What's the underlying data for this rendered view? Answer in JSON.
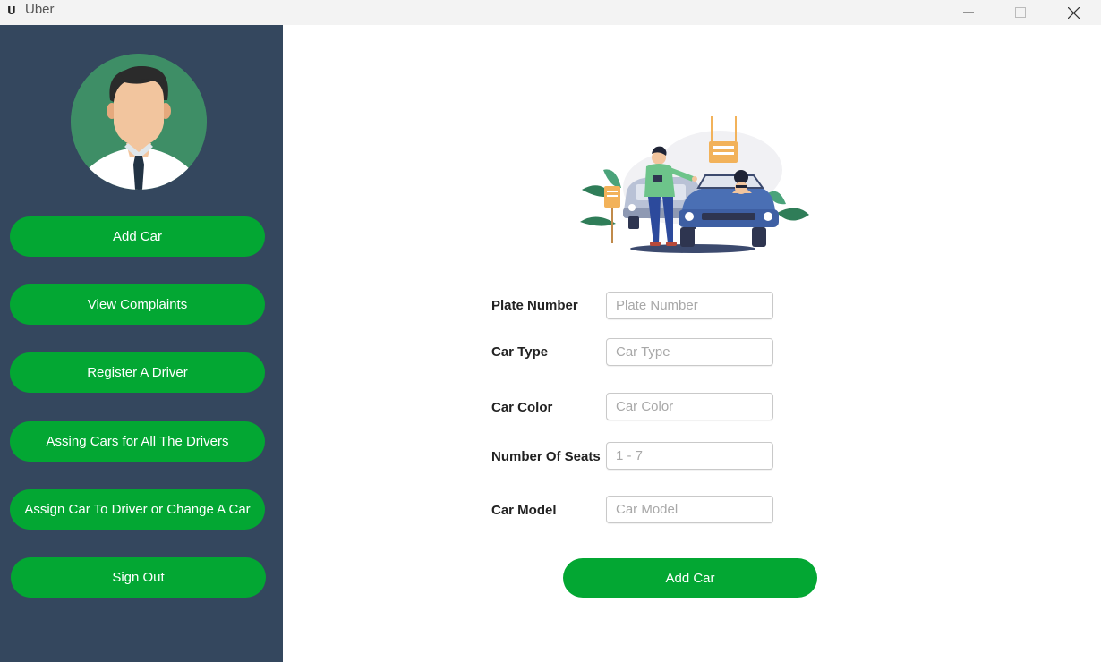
{
  "window": {
    "title": "Uber",
    "icon": "U"
  },
  "sidebar": {
    "items": [
      {
        "label": "Add Car"
      },
      {
        "label": "View Complaints"
      },
      {
        "label": "Register A Driver"
      },
      {
        "label": "Assing Cars for All The Drivers"
      },
      {
        "label": "Assign Car To Driver or Change A Car"
      },
      {
        "label": "Sign Out"
      }
    ]
  },
  "form": {
    "fields": [
      {
        "label": "Plate Number",
        "placeholder": "Plate Number",
        "value": ""
      },
      {
        "label": "Car Type",
        "placeholder": "Car Type",
        "value": ""
      },
      {
        "label": "Car Color",
        "placeholder": "Car Color",
        "value": ""
      },
      {
        "label": "Number Of Seats",
        "placeholder": "1 - 7",
        "value": ""
      },
      {
        "label": "Car Model",
        "placeholder": "Car Model",
        "value": ""
      }
    ],
    "submit_label": "Add Car"
  },
  "colors": {
    "accent": "#03a733",
    "sidebar_bg": "#34475e",
    "avatar_bg": "#3e8e66"
  }
}
